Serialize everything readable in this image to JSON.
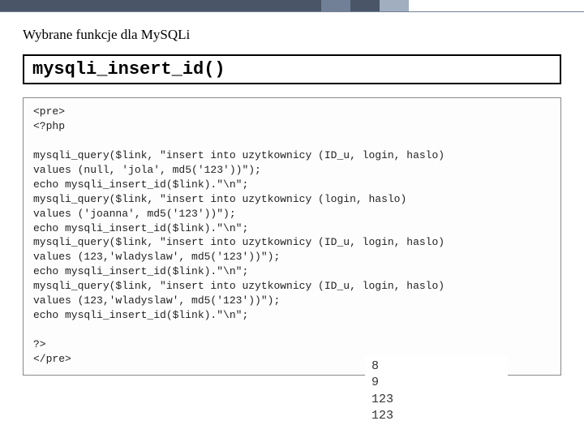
{
  "header": {
    "subtitle": "Wybrane funkcje dla MySQLi",
    "function_name": "mysqli_insert_id()"
  },
  "code": "<pre>\n<?php\n\nmysqli_query($link, \"insert into uzytkownicy (ID_u, login, haslo)\nvalues (null, 'jola', md5('123'))\");\necho mysqli_insert_id($link).\"\\n\";\nmysqli_query($link, \"insert into uzytkownicy (login, haslo)\nvalues ('joanna', md5('123'))\");\necho mysqli_insert_id($link).\"\\n\";\nmysqli_query($link, \"insert into uzytkownicy (ID_u, login, haslo)\nvalues (123,'wladyslaw', md5('123'))\");\necho mysqli_insert_id($link).\"\\n\";\nmysqli_query($link, \"insert into uzytkownicy (ID_u, login, haslo)\nvalues (123,'wladyslaw', md5('123'))\");\necho mysqli_insert_id($link).\"\\n\";\n\n?>\n</pre>",
  "output": "8\n9\n123\n123"
}
